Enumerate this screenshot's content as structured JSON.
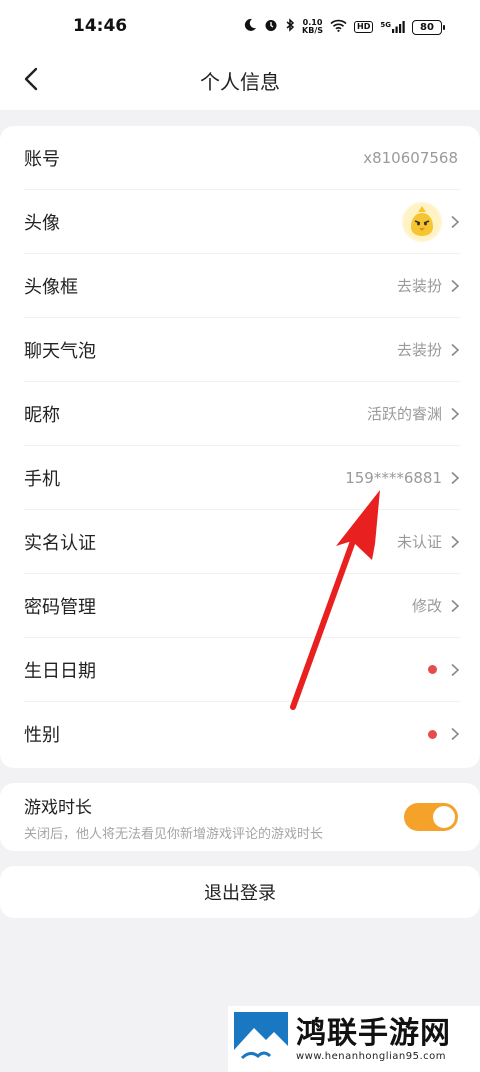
{
  "status_bar": {
    "time": "14:46",
    "net_speed_value": "0.10",
    "net_speed_unit": "KB/S",
    "hd": "HD",
    "signal": "5G",
    "battery": "80"
  },
  "header": {
    "title": "个人信息",
    "back_icon": "chevron-left-icon"
  },
  "profile_rows": [
    {
      "label": "账号",
      "value": "x810607568"
    },
    {
      "label": "头像",
      "value": ""
    },
    {
      "label": "头像框",
      "value": "去装扮"
    },
    {
      "label": "聊天气泡",
      "value": "去装扮"
    },
    {
      "label": "昵称",
      "value": "活跃的睿渊"
    },
    {
      "label": "手机",
      "value": "159****6881"
    },
    {
      "label": "实名认证",
      "value": "未认证"
    },
    {
      "label": "密码管理",
      "value": "修改"
    },
    {
      "label": "生日日期",
      "value": ""
    },
    {
      "label": "性别",
      "value": ""
    }
  ],
  "game_time": {
    "label": "游戏时长",
    "description": "关闭后，他人将无法看见你新增游戏评论的游戏时长",
    "enabled": true
  },
  "logout_label": "退出登录",
  "colors": {
    "accent": "#f5a22a",
    "notice_dot": "#e74c4c",
    "annotation_arrow": "#e8201f"
  },
  "watermark": {
    "title": "鸿联手游网",
    "url": "www.henanhonglian95.com"
  }
}
